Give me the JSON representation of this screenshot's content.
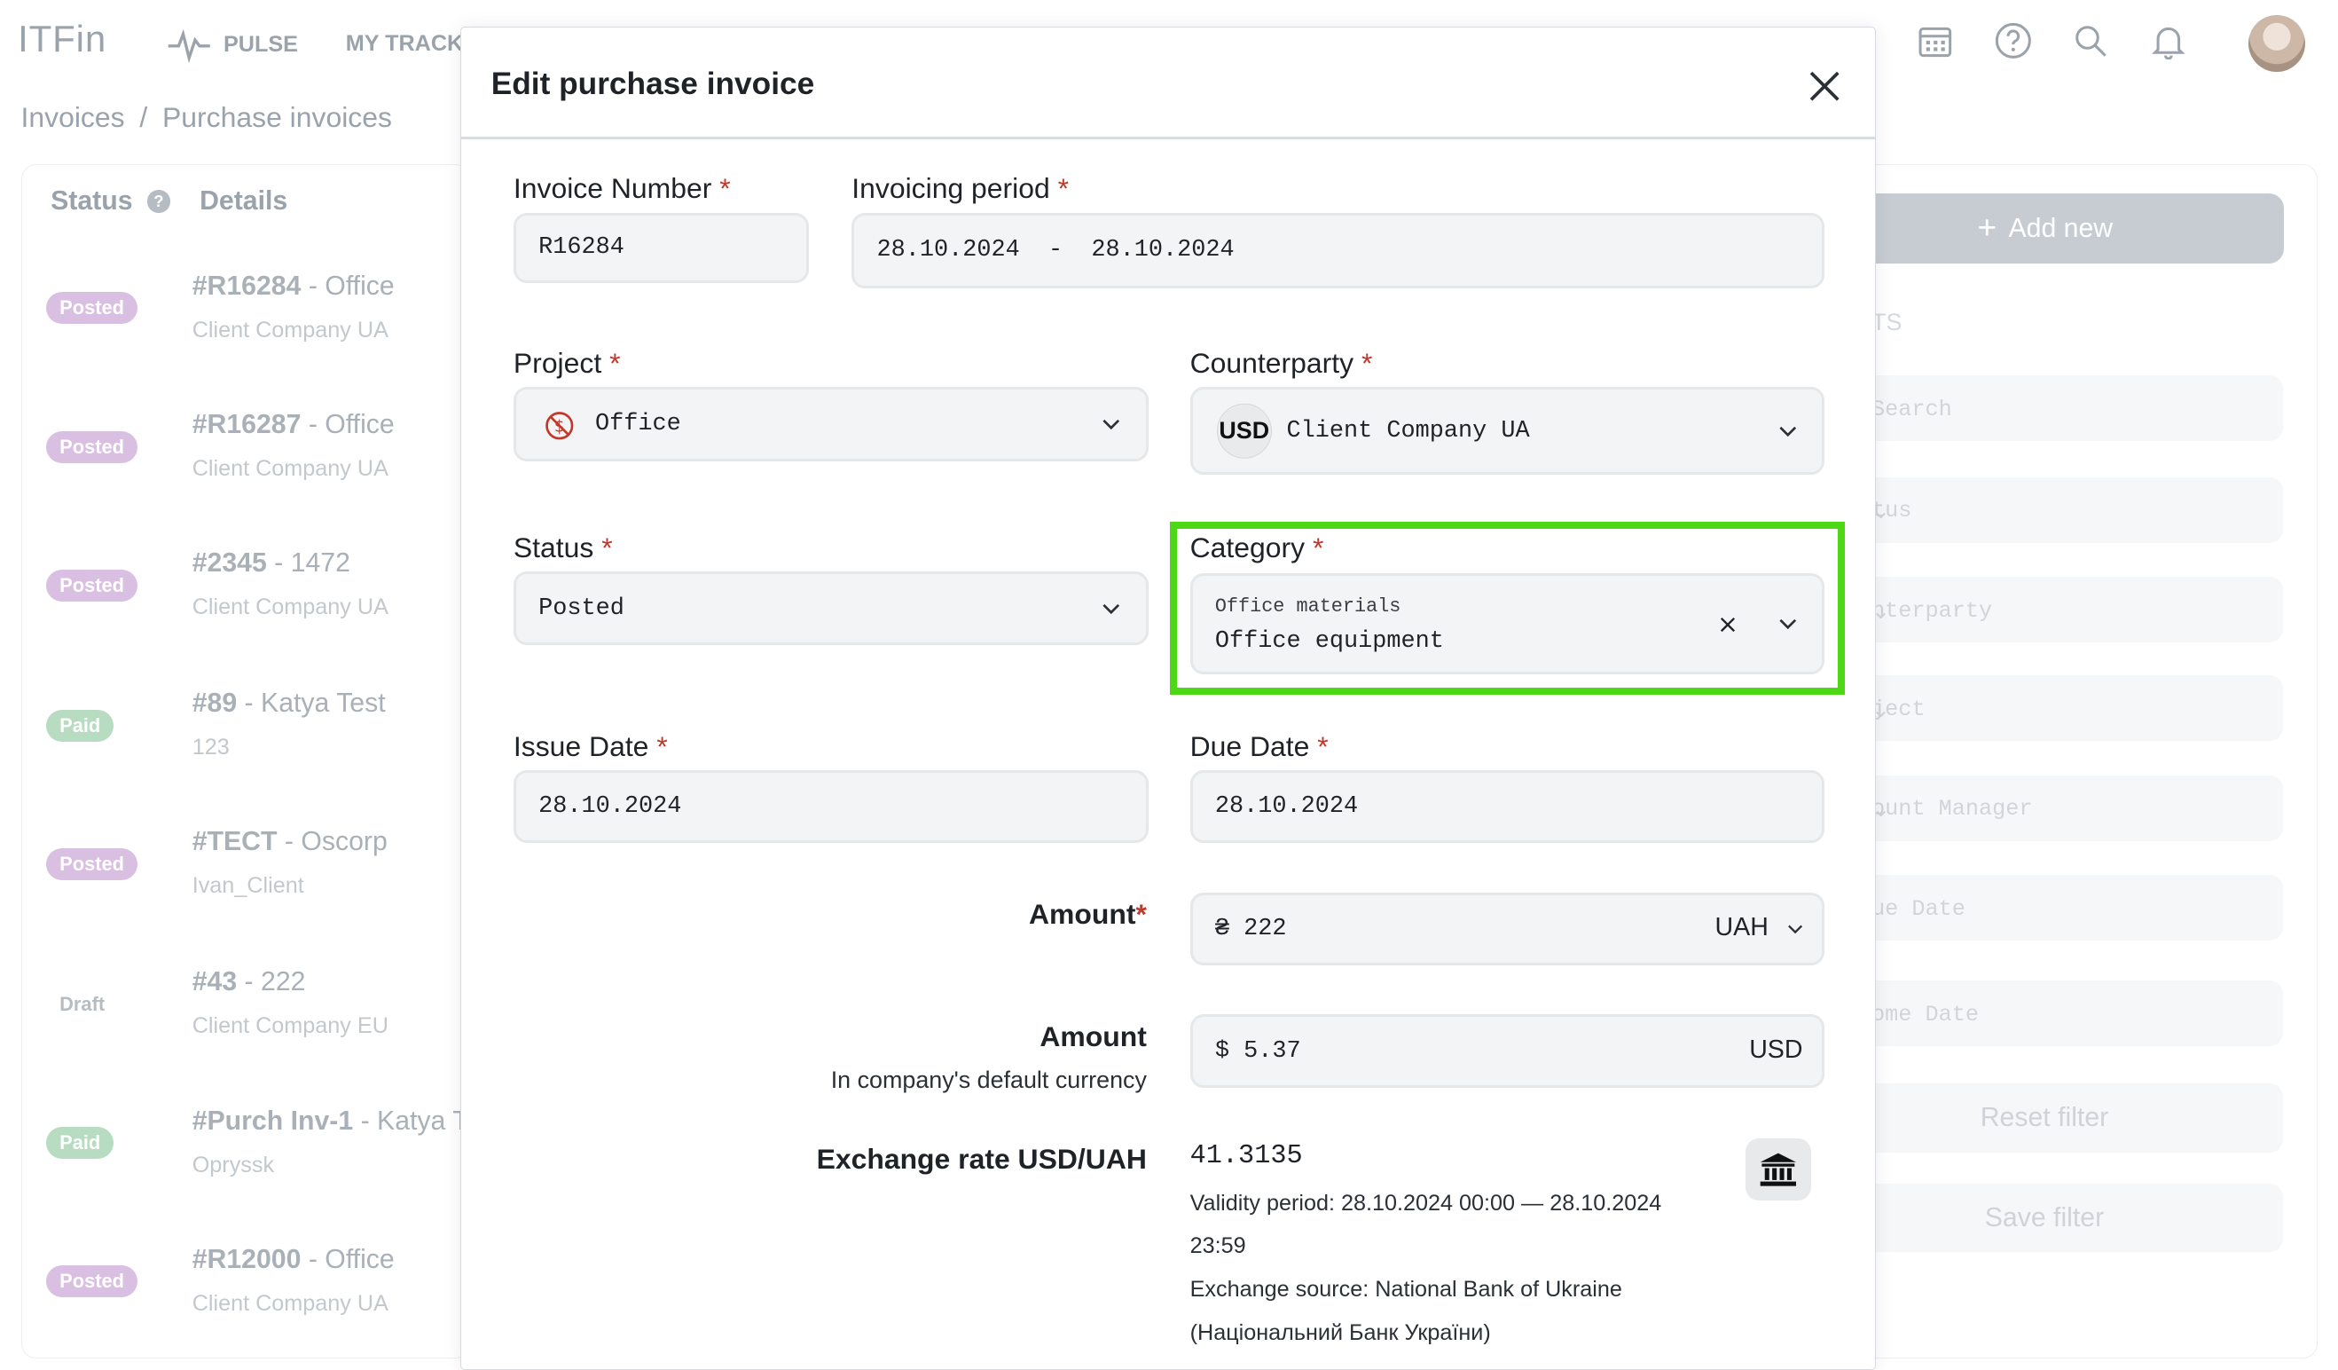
{
  "app": {
    "logo": "ITFin",
    "nav": {
      "pulse": "PULSE",
      "tracker": "MY TRACKE"
    }
  },
  "breadcrumb": {
    "root": "Invoices",
    "separator": "/",
    "current": "Purchase invoices"
  },
  "list": {
    "headers": {
      "status": "Status",
      "details": "Details"
    },
    "rows": [
      {
        "status": "Posted",
        "number": "#R16284",
        "name": " - Office",
        "client": "Client Company UA"
      },
      {
        "status": "Posted",
        "number": "#R16287",
        "name": " - Office",
        "client": "Client Company UA"
      },
      {
        "status": "Posted",
        "number": "#2345",
        "name": " - 1472",
        "client": "Client Company UA"
      },
      {
        "status": "Paid",
        "number": "#89",
        "name": " - Katya Test",
        "client": "123"
      },
      {
        "status": "Posted",
        "number": "#TECT",
        "name": " - Oscorp",
        "client": "Ivan_Client"
      },
      {
        "status": "Draft",
        "number": "#43",
        "name": " - 222",
        "client": "Client Company EU"
      },
      {
        "status": "Paid",
        "number": "#Purch Inv-1",
        "name": " - Katya T",
        "client": "Opryssk"
      },
      {
        "status": "Posted",
        "number": "#R12000",
        "name": " - Office",
        "client": "Client Company UA"
      }
    ]
  },
  "filters": {
    "add_new": "Add new",
    "section_label": "TS",
    "search_placeholder": "Search",
    "fields": [
      "tus",
      "nterparty",
      "ject",
      "ount Manager",
      "ue Date",
      "ome Date"
    ],
    "reset": "Reset filter",
    "save": "Save filter"
  },
  "modal": {
    "title": "Edit purchase invoice",
    "required_mark": "*",
    "invoice_number": {
      "label": "Invoice Number",
      "value": "R16284"
    },
    "invoicing_period": {
      "label": "Invoicing period",
      "value": "28.10.2024  -  28.10.2024"
    },
    "project": {
      "label": "Project",
      "value": "Office"
    },
    "counterparty": {
      "label": "Counterparty",
      "currency_badge": "USD",
      "value": "Client Company UA"
    },
    "status": {
      "label": "Status",
      "value": "Posted"
    },
    "category": {
      "label": "Category",
      "parent": "Office materials",
      "value": "Office equipment",
      "clear": "×"
    },
    "issue_date": {
      "label": "Issue Date",
      "value": "28.10.2024"
    },
    "due_date": {
      "label": "Due Date",
      "value": "28.10.2024"
    },
    "amount": {
      "label": "Amount",
      "symbol": "₴",
      "value": "222",
      "currency": "UAH"
    },
    "amount_default": {
      "label": "Amount",
      "sublabel": "In company's default currency",
      "symbol": "$",
      "value": "5.37",
      "currency": "USD"
    },
    "exchange": {
      "label": "Exchange rate USD/UAH",
      "rate": "41.3135",
      "validity_line1": "Validity period: 28.10.2024 00:00 — 28.10.2024",
      "validity_line2": "23:59",
      "source_line1": "Exchange source: National Bank of Ukraine",
      "source_line2": "(Національний Банк України)"
    }
  },
  "colors": {
    "highlight": "#4cd815",
    "required": "#c0392b",
    "posted_badge": "#d9bfe2",
    "paid_badge": "#b8dcc2"
  }
}
